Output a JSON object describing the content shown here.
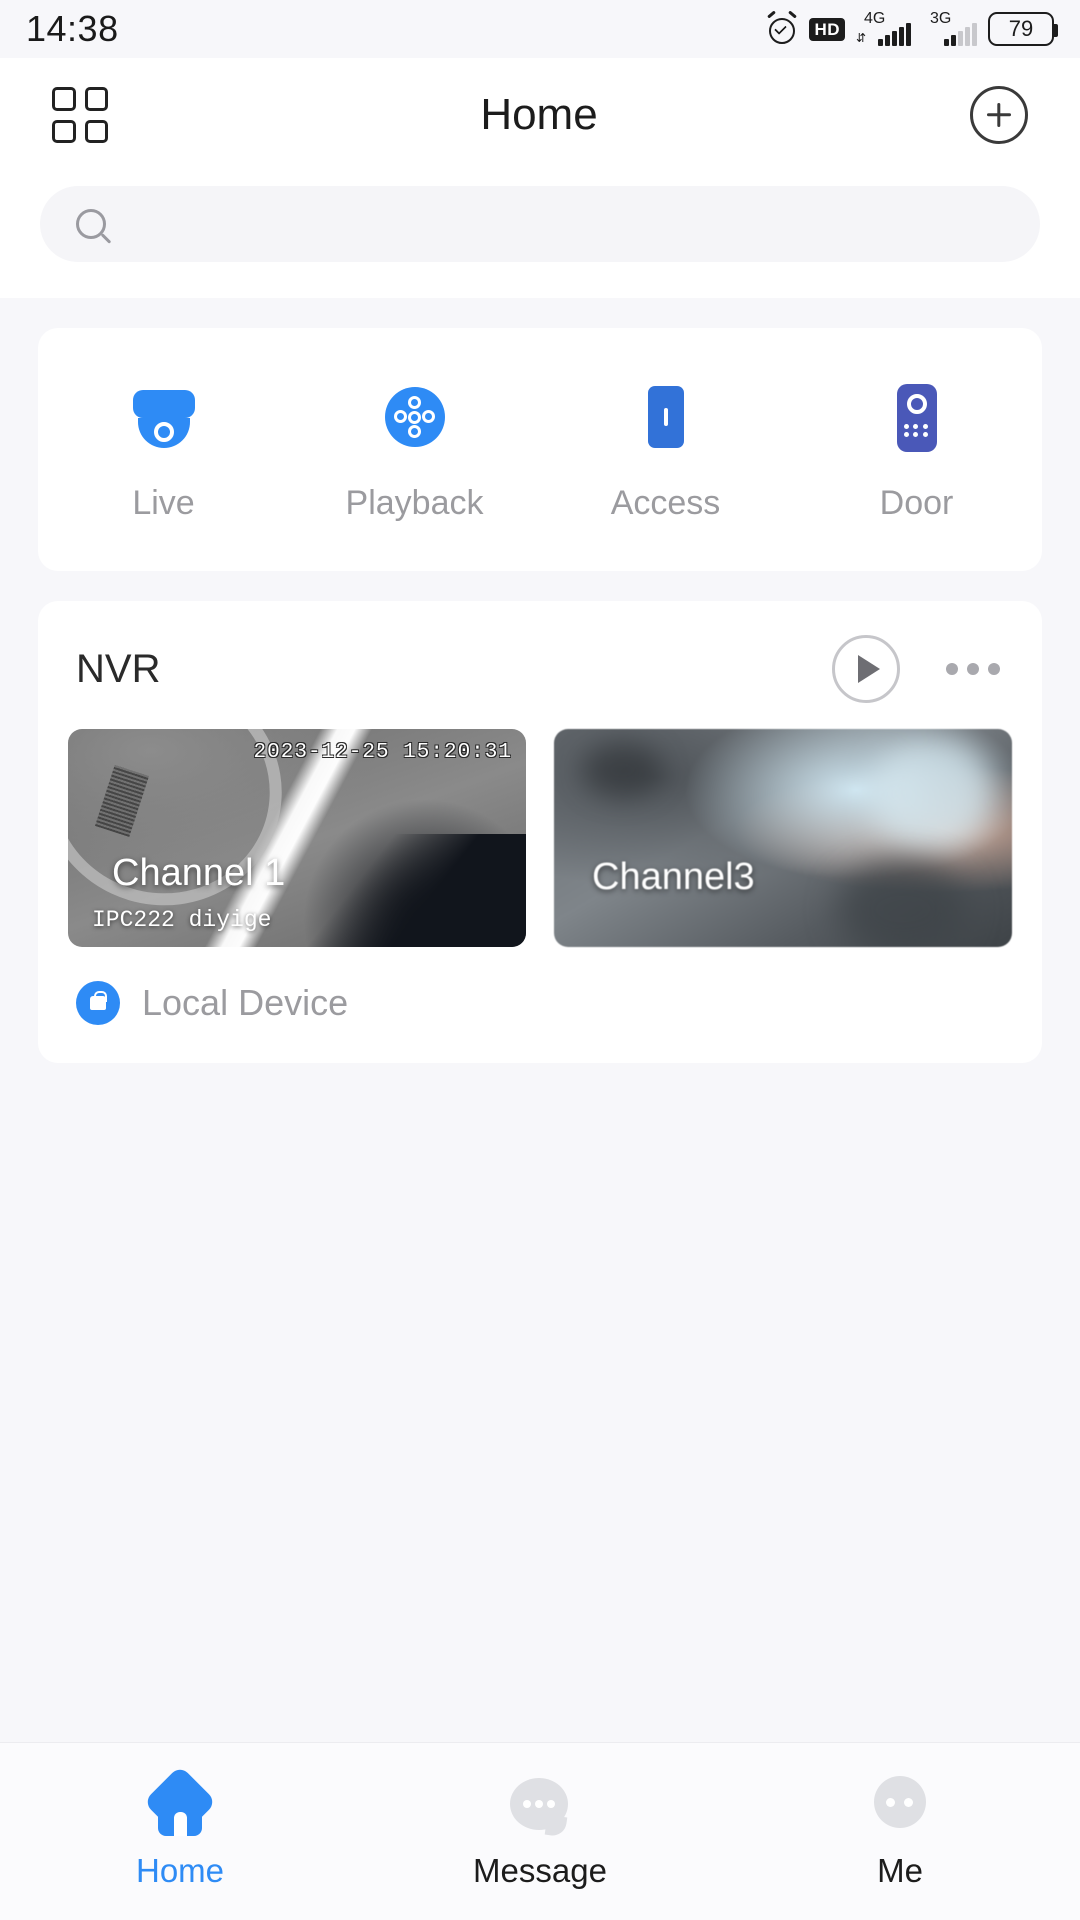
{
  "status_bar": {
    "time": "14:38",
    "alarm_icon": "alarm-clock-icon",
    "hd_badge": "HD",
    "network_1": "4G",
    "network_2": "3G",
    "battery_level": "79"
  },
  "header": {
    "grid_icon": "grid-menu-icon",
    "title": "Home",
    "add_icon": "add-plus-icon"
  },
  "search": {
    "value": "",
    "placeholder": "",
    "icon": "search-icon"
  },
  "quick_actions": [
    {
      "label": "Live",
      "icon": "dome-camera-icon",
      "color": "#2e8bf5"
    },
    {
      "label": "Playback",
      "icon": "playback-circle-icon",
      "color": "#2e8bf5"
    },
    {
      "label": "Access",
      "icon": "access-door-icon",
      "color": "#3272d8"
    },
    {
      "label": "Door",
      "icon": "door-intercom-icon",
      "color": "#4a58b8"
    }
  ],
  "device": {
    "name": "NVR",
    "play_icon": "play-icon",
    "more_icon": "more-options-icon",
    "channels": [
      {
        "name": "Channel 1",
        "subtitle": "IPC222 diyige",
        "timestamp": "2023-12-25 15:20:31"
      },
      {
        "name": "Channel3",
        "subtitle": "",
        "timestamp": ""
      }
    ],
    "local_device_label": "Local Device",
    "local_device_icon": "cloud-lock-icon"
  },
  "tabbar": {
    "active_color": "#2e8bf5",
    "items": [
      {
        "label": "Home",
        "icon": "home-icon",
        "active": true
      },
      {
        "label": "Message",
        "icon": "message-icon",
        "active": false
      },
      {
        "label": "Me",
        "icon": "person-icon",
        "active": false
      }
    ]
  }
}
